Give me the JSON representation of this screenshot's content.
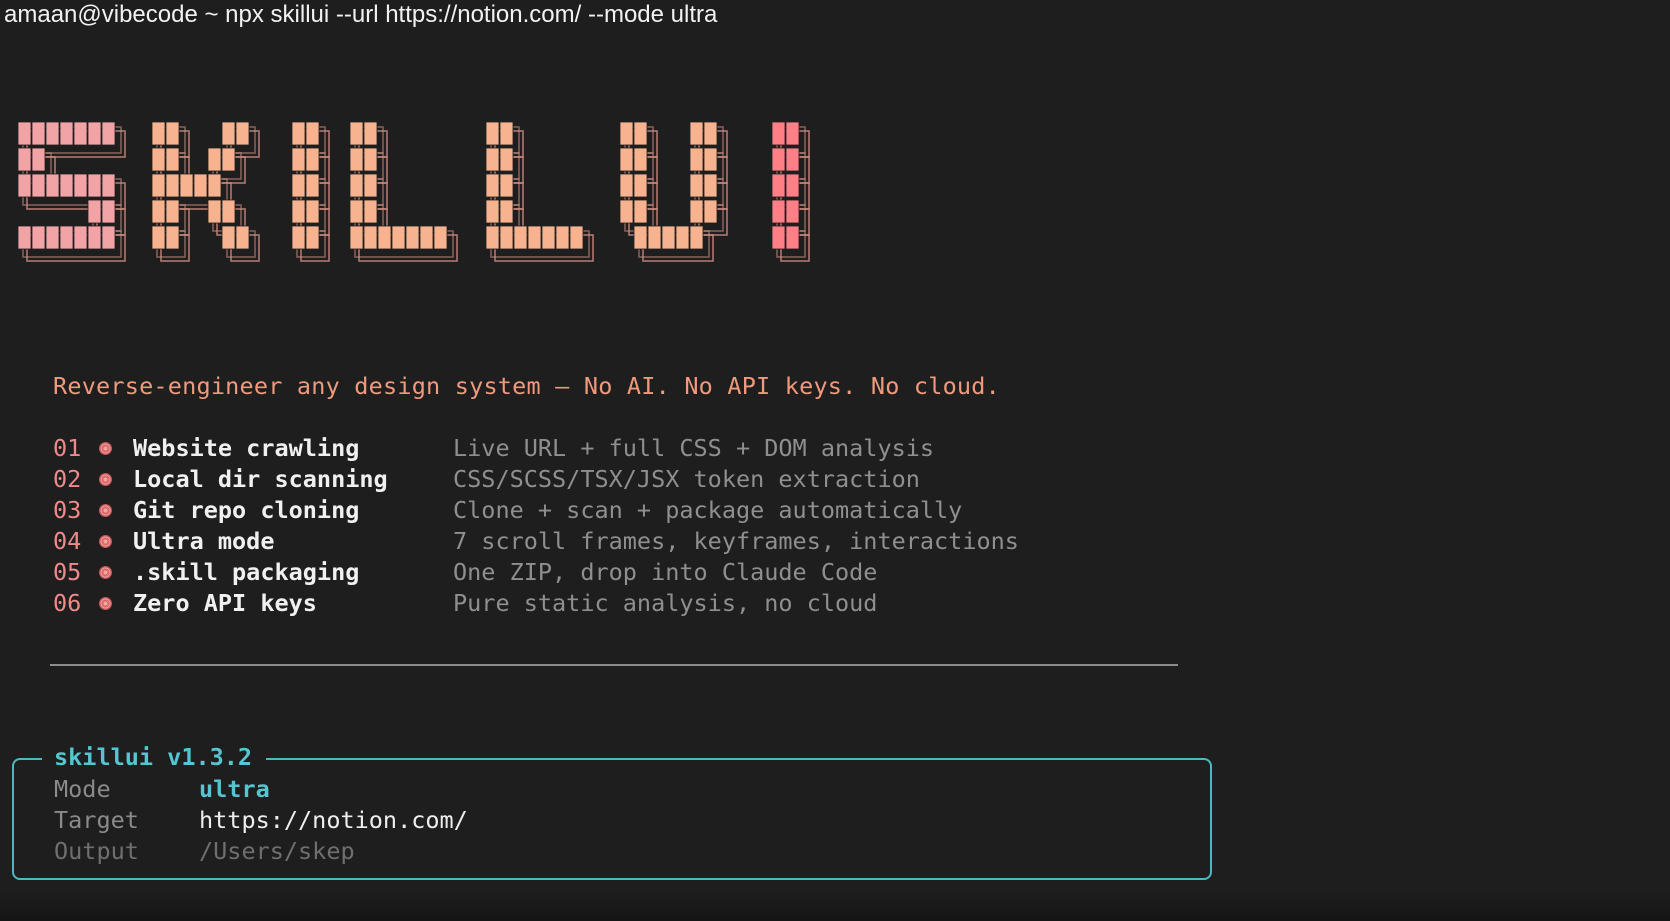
{
  "terminal": {
    "prompt_line": "amaan@vibecode ~ npx skillui --url https://notion.com/ --mode ultra"
  },
  "logo": {
    "text": "SKILLUI",
    "colors": {
      "S": "#f2a3a6",
      "K": "#f7b38f",
      "I1": "#f7b38f",
      "L1": "#f7b38f",
      "L2": "#f7b38f",
      "U": "#f7b38f",
      "I2": "#ff7f86"
    },
    "outline_color": "#c98a7e"
  },
  "tagline": "Reverse-engineer any design system — No AI. No API keys. No cloud.",
  "features": [
    {
      "num": "01",
      "title": "Website crawling",
      "desc": "Live URL + full CSS + DOM analysis"
    },
    {
      "num": "02",
      "title": "Local dir scanning",
      "desc": "CSS/SCSS/TSX/JSX token extraction"
    },
    {
      "num": "03",
      "title": "Git repo cloning",
      "desc": "Clone + scan + package automatically"
    },
    {
      "num": "04",
      "title": "Ultra mode",
      "desc": "7 scroll frames, keyframes, interactions"
    },
    {
      "num": "05",
      "title": ".skill packaging",
      "desc": "One ZIP, drop into Claude Code"
    },
    {
      "num": "06",
      "title": "Zero API keys",
      "desc": "Pure static analysis, no cloud"
    }
  ],
  "info_box": {
    "title": "skillui v1.3.2",
    "mode_label": "Mode",
    "mode_value": "ultra",
    "target_label": "Target",
    "target_value": "https://notion.com/",
    "output_label": "Output",
    "output_value": "/Users/skep"
  },
  "icons": {
    "feature_bullet": "pink-dot-icon"
  }
}
